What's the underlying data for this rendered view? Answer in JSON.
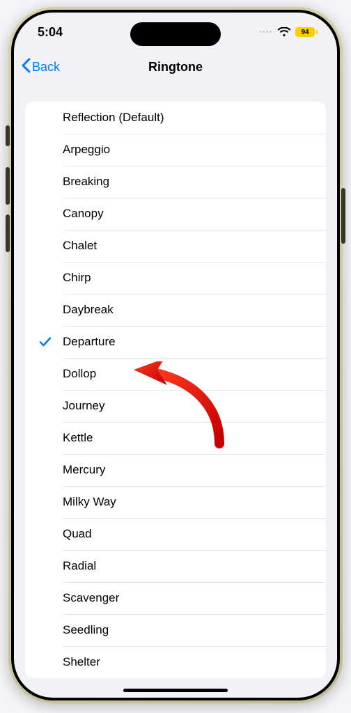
{
  "status": {
    "time": "5:04",
    "battery_level": "94"
  },
  "nav": {
    "back_label": "Back",
    "title": "Ringtone"
  },
  "ringtones": {
    "selected_index": 7,
    "items": [
      {
        "label": "Reflection (Default)"
      },
      {
        "label": "Arpeggio"
      },
      {
        "label": "Breaking"
      },
      {
        "label": "Canopy"
      },
      {
        "label": "Chalet"
      },
      {
        "label": "Chirp"
      },
      {
        "label": "Daybreak"
      },
      {
        "label": "Departure"
      },
      {
        "label": "Dollop"
      },
      {
        "label": "Journey"
      },
      {
        "label": "Kettle"
      },
      {
        "label": "Mercury"
      },
      {
        "label": "Milky Way"
      },
      {
        "label": "Quad"
      },
      {
        "label": "Radial"
      },
      {
        "label": "Scavenger"
      },
      {
        "label": "Seedling"
      },
      {
        "label": "Shelter"
      }
    ]
  },
  "annotation": {
    "target": "Departure",
    "color": "#e30b0b"
  }
}
